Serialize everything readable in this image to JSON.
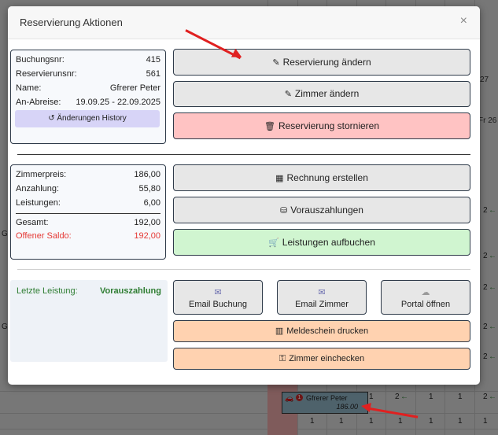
{
  "modal": {
    "title": "Reservierung Aktionen",
    "close_glyph": "×"
  },
  "info": {
    "buchungsnr_label": "Buchungsnr:",
    "buchungsnr": "415",
    "reservierungsnr_label": "Reservierunsnr:",
    "reservierungsnr": "561",
    "name_label": "Name:",
    "name": "Gfrerer Peter",
    "an_abreise_label": "An-Abreise:",
    "an_abreise": "19.09.25 - 22.09.2025",
    "history_button": "Änderungen History"
  },
  "pricing": {
    "zimmerpreis_label": "Zimmerpreis:",
    "zimmerpreis": "186,00",
    "anzahlung_label": "Anzahlung:",
    "anzahlung": "55,80",
    "leistungen_label": "Leistungen:",
    "leistungen": "6,00",
    "gesamt_label": "Gesamt:",
    "gesamt": "192,00",
    "offener_saldo_label": "Offener Saldo:",
    "offener_saldo": "192,00"
  },
  "last_service": {
    "label": "Letzte Leistung:",
    "value": "Vorauszahlung"
  },
  "actions": {
    "reservierung_aendern": "Reservierung ändern",
    "zimmer_aendern": "Zimmer ändern",
    "reservierung_stornieren": "Reservierung stornieren",
    "rechnung_erstellen": "Rechnung erstellen",
    "vorauszahlungen": "Vorauszahlungen",
    "leistungen_aufbuchen": "Leistungen aufbuchen",
    "email_buchung": "Email Buchung",
    "email_zimmer": "Email Zimmer",
    "portal_oeffnen": "Portal öffnen",
    "meldeschein_drucken": "Meldeschein drucken",
    "zimmer_einchecken": "Zimmer einchecken"
  },
  "background": {
    "header_27": "27",
    "header_fr26": "Fr 26",
    "booking_name": "Gfrerer Peter",
    "booking_price": "186.00",
    "booking_badge": "1",
    "cell_1": "1",
    "cell_2": "2",
    "left_g1": "G",
    "left_g2": "G"
  },
  "colors": {
    "danger": "#ffc3c3",
    "success": "#d0f5d0",
    "warning": "#ffd2b0",
    "history": "#d7d4f7",
    "saldo_red": "#e53935",
    "green_text": "#2e7d32",
    "annotation_arrow": "#e02020"
  }
}
